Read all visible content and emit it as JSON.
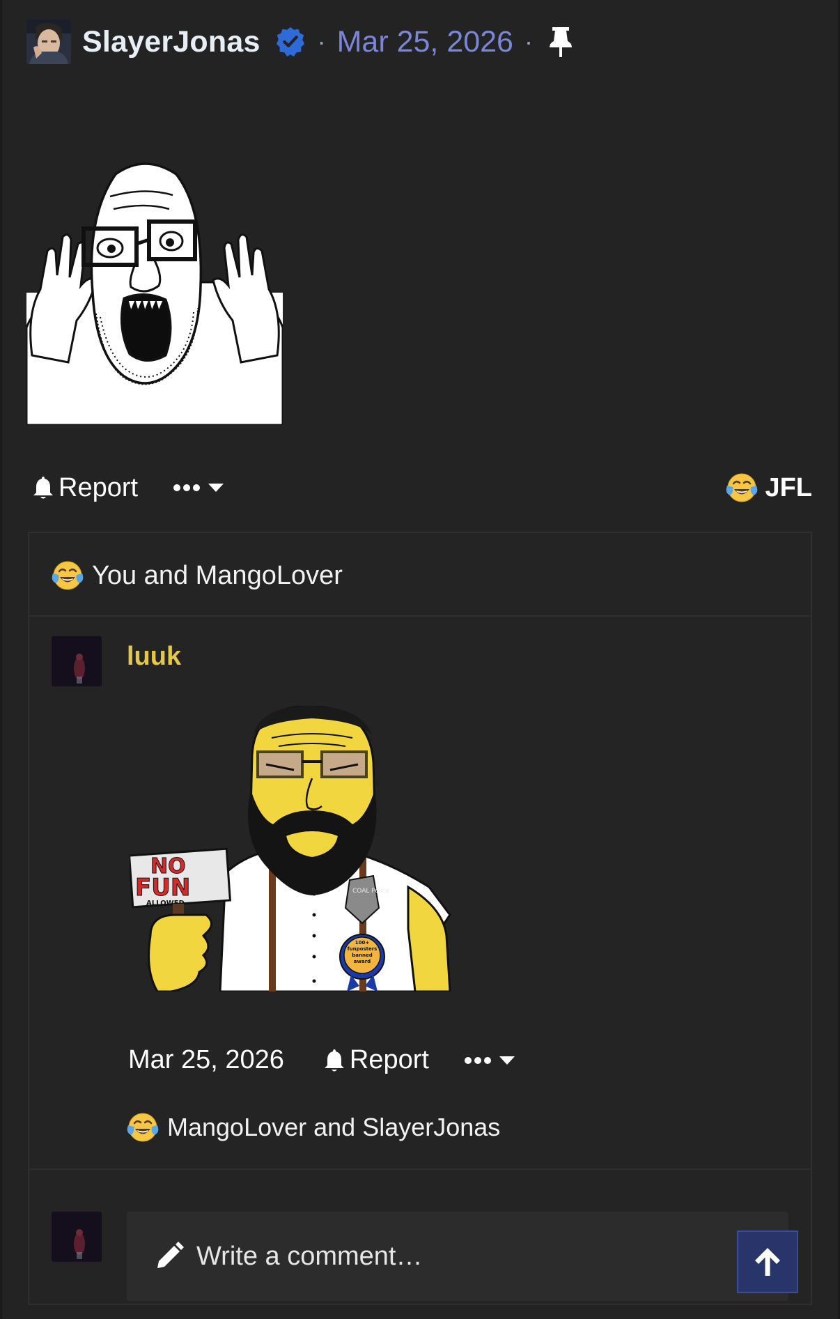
{
  "post": {
    "author": "SlayerJonas",
    "separator": "·",
    "date": "Mar 25, 2026",
    "actions": {
      "report_label": "Report"
    },
    "reaction_summary": {
      "emoji": "face-with-tears-of-joy",
      "label": "JFL"
    },
    "reactors_text": "You and MangoLover"
  },
  "comment": {
    "author": "luuk",
    "date": "Mar 25, 2026",
    "report_label": "Report",
    "reactors_text": "MangoLover and SlayerJonas",
    "image_text": {
      "sign_line1": "NO",
      "sign_line2": "FUN",
      "sign_line3": "ALLOWED",
      "badge_top": "COAL Police",
      "ribbon": "100+ funposters banned award"
    }
  },
  "reply": {
    "placeholder": "Write a comment…"
  },
  "colors": {
    "background": "#232323",
    "username_main": "#e8eef6",
    "date_link": "#7a86d8",
    "comment_user": "#e3c94a",
    "verified": "#2f6bd8",
    "scroll_top_bg": "#27356b"
  }
}
